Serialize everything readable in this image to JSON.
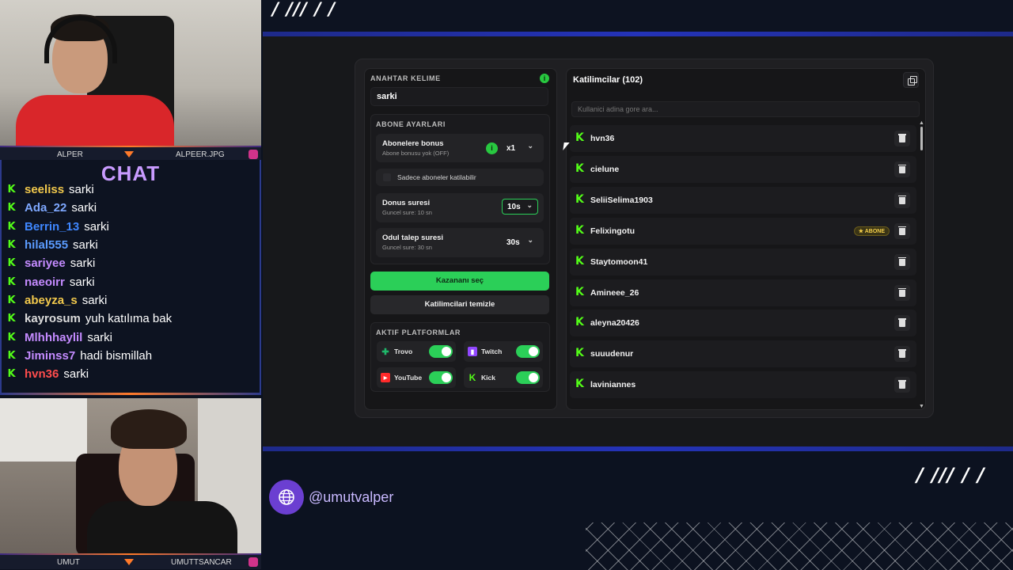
{
  "cam_top": {
    "name_left": "ALPER",
    "name_right": "ALPEER.JPG"
  },
  "cam_bottom": {
    "name_left": "UMUT",
    "name_right": "UMUTTSANCAR"
  },
  "chat": {
    "title": "CHAT",
    "messages": [
      {
        "user": "seeliss",
        "text": "sarki",
        "color": "#f2c94c"
      },
      {
        "user": "Ada_22",
        "text": "sarki",
        "color": "#7ea8ff"
      },
      {
        "user": "Berrin_13",
        "text": "sarki",
        "color": "#3f87ff"
      },
      {
        "user": "hilal555",
        "text": "sarki",
        "color": "#5b9cff"
      },
      {
        "user": "sariyee",
        "text": "sarki",
        "color": "#c48bff"
      },
      {
        "user": "naeoirr",
        "text": "sarki",
        "color": "#c48bff"
      },
      {
        "user": "abeyza_s",
        "text": "sarki",
        "color": "#f2c94c"
      },
      {
        "user": "kayrosum",
        "text": "yuh katılıma bak",
        "color": "#dcdcdc"
      },
      {
        "user": "Mlhhhaylil",
        "text": "sarki",
        "color": "#c48bff"
      },
      {
        "user": "Jiminss7",
        "text": "hadi bismillah",
        "color": "#c48bff"
      },
      {
        "user": "hvn36",
        "text": "sarki",
        "color": "#ff4d4d"
      }
    ]
  },
  "overlay": {
    "handle": "@umutvalper",
    "slashes_top": "/ /// / /",
    "slashes_bottom": "/ /// / /"
  },
  "keyword": {
    "label": "ANAHTAR KELIME",
    "value": "sarki"
  },
  "subscriber_settings": {
    "label": "ABONE AYARLARI",
    "bonus_title": "Abonelere bonus",
    "bonus_sub": "Abone bonusu yok (OFF)",
    "bonus_value": "x1",
    "only_subs_label": "Sadece aboneler katilabilir",
    "spin_title": "Donus suresi",
    "spin_sub": "Guncel sure: 10 sn",
    "spin_value": "10s",
    "claim_title": "Odul talep suresi",
    "claim_sub": "Guncel sure: 30 sn",
    "claim_value": "30s"
  },
  "buttons": {
    "pick_winner": "Kazananı seç",
    "clear_participants": "Katilimcilari temizle"
  },
  "platforms": {
    "label": "AKTIF PLATFORMLAR",
    "items": [
      {
        "name": "Trovo",
        "enabled": true
      },
      {
        "name": "Twitch",
        "enabled": true
      },
      {
        "name": "YouTube",
        "enabled": true
      },
      {
        "name": "Kick",
        "enabled": true
      }
    ]
  },
  "participants": {
    "title": "Katilimcilar (102)",
    "search_placeholder": "Kullanici adina gore ara...",
    "badge_label": "ABONE",
    "list": [
      "hvn36",
      "cielune",
      "SeliiSelima1903",
      "Felixingotu",
      "Staytomoon41",
      "Amineee_26",
      "aleyna20426",
      "suuudenur",
      "laviniannes"
    ],
    "subscriber": "Felixingotu"
  },
  "colors": {
    "accent_green": "#2bcf58",
    "kick_green": "#53fc18",
    "overlay_blue": "#2433b8",
    "chat_title": "#c89bff"
  }
}
